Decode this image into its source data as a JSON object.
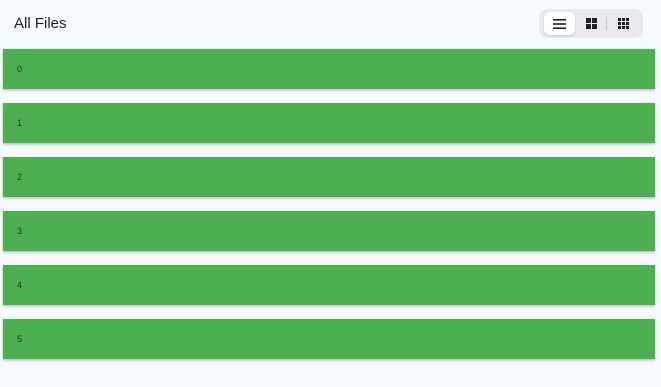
{
  "header": {
    "title": "All Files"
  },
  "view_switcher": {
    "options": [
      {
        "icon": "list-view-icon",
        "active": true
      },
      {
        "icon": "grid-view-icon",
        "active": false
      },
      {
        "icon": "compact-grid-view-icon",
        "active": false
      }
    ]
  },
  "files": [
    {
      "label": "0"
    },
    {
      "label": "1"
    },
    {
      "label": "2"
    },
    {
      "label": "3"
    },
    {
      "label": "4"
    },
    {
      "label": "5"
    }
  ],
  "colors": {
    "row_background": "#4caf50",
    "page_background": "#f7fafd",
    "switcher_background": "#e8eaed"
  }
}
